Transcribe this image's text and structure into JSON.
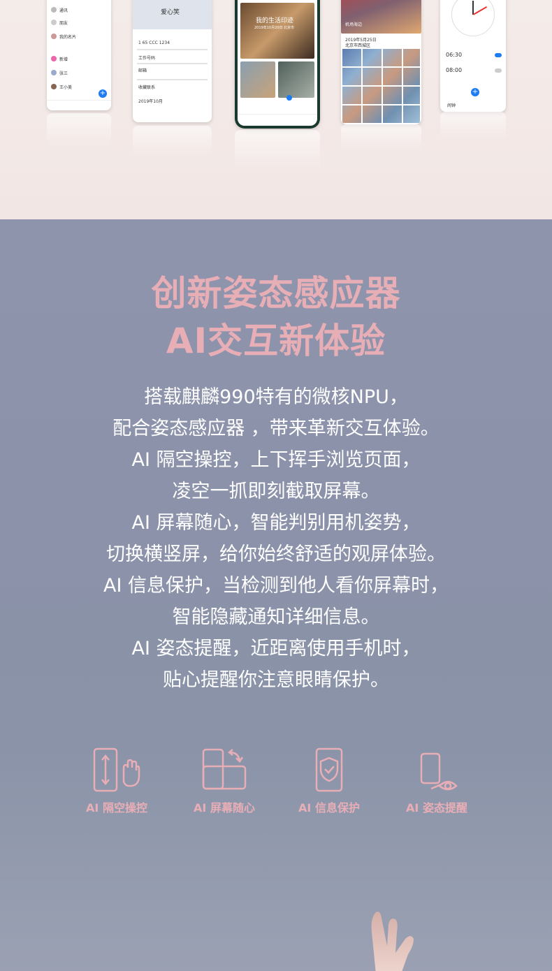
{
  "top_preview": {
    "phones": [
      {
        "name": "contacts-screen",
        "labels": [
          "通讯",
          "朋友",
          "我的名片",
          "新增",
          "张三",
          "王小美"
        ]
      },
      {
        "name": "profile-screen",
        "labels": [
          "爱心笑",
          "1 65 CCC 1234",
          "工作号码",
          "邮箱",
          "收藏联系",
          "2019年10月"
        ]
      },
      {
        "name": "gallery-screen",
        "labels": [
          "我的生活印迹",
          "2019年10月20日 北京市"
        ]
      },
      {
        "name": "photos-screen",
        "labels": [
          "机场海边",
          "2019年5月25日",
          "北京市西城区"
        ]
      },
      {
        "name": "clock-screen",
        "labels": [
          "06:30",
          "08:00",
          "闹钟"
        ]
      }
    ]
  },
  "headline": {
    "line1": "创新姿态感应器",
    "line2": "AI交互新体验"
  },
  "description": [
    "搭载麒麟990特有的微核NPU，",
    "配合姿态感应器 ，带来革新交互体验。",
    "AI 隔空操控，上下挥手浏览页面，",
    "凌空一抓即刻截取屏幕。",
    "AI 屏幕随心，智能判别用机姿势，",
    "切换横竖屏，给你始终舒适的观屏体验。",
    "AI 信息保护，当检测到他人看你屏幕时，",
    "智能隐藏通知详细信息。",
    "AI 姿态提醒，近距离使用手机时，",
    "贴心提醒你注意眼睛保护。"
  ],
  "features": [
    {
      "label": "AI 隔空操控",
      "icon": "air-gesture-icon"
    },
    {
      "label": "AI 屏幕随心",
      "icon": "screen-rotate-icon"
    },
    {
      "label": "AI 信息保护",
      "icon": "privacy-shield-icon"
    },
    {
      "label": "AI 姿态提醒",
      "icon": "eye-care-icon"
    }
  ],
  "colors": {
    "accent_pink": "#e8aeb6",
    "background_top": "#f3e9e7",
    "background_bottom": "#8c93a8"
  }
}
